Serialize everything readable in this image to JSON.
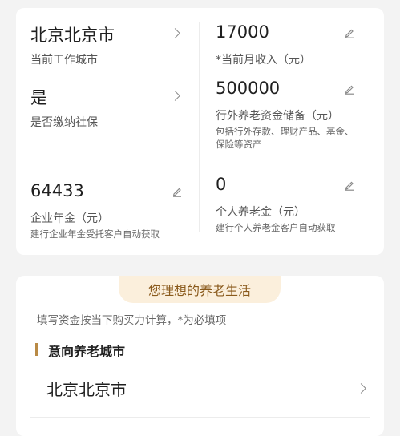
{
  "card_top": {
    "work_city": {
      "value": "北京北京市",
      "label": "当前工作城市"
    },
    "monthly_income": {
      "value": "17000",
      "label": "*当前月收入（元）"
    },
    "social_security": {
      "value": "是",
      "label": "是否缴纳社保"
    },
    "off_bank_savings": {
      "value": "500000",
      "label": "行外养老资金储备（元）",
      "hint": "包括行外存款、理财产品、基金、保险等资产"
    },
    "enterprise_annuity": {
      "value": "64433",
      "label": "企业年金（元）",
      "hint": "建行企业年金受托客户自动获取"
    },
    "personal_pension": {
      "value": "0",
      "label": "个人养老金（元）",
      "hint": "建行个人养老金客户自动获取"
    }
  },
  "card_bottom": {
    "badge": "您理想的养老生活",
    "subtitle": "填写资金按当下购买力计算，*为必填项",
    "section_title": "意向养老城市",
    "retire_city": "北京北京市"
  },
  "icons": {
    "chevron": "chevron-right-icon",
    "edit": "pencil-edit-icon"
  },
  "colors": {
    "accent": "#b98a45",
    "badge_bg": "#fbefdc",
    "badge_text": "#8a5a1c"
  }
}
